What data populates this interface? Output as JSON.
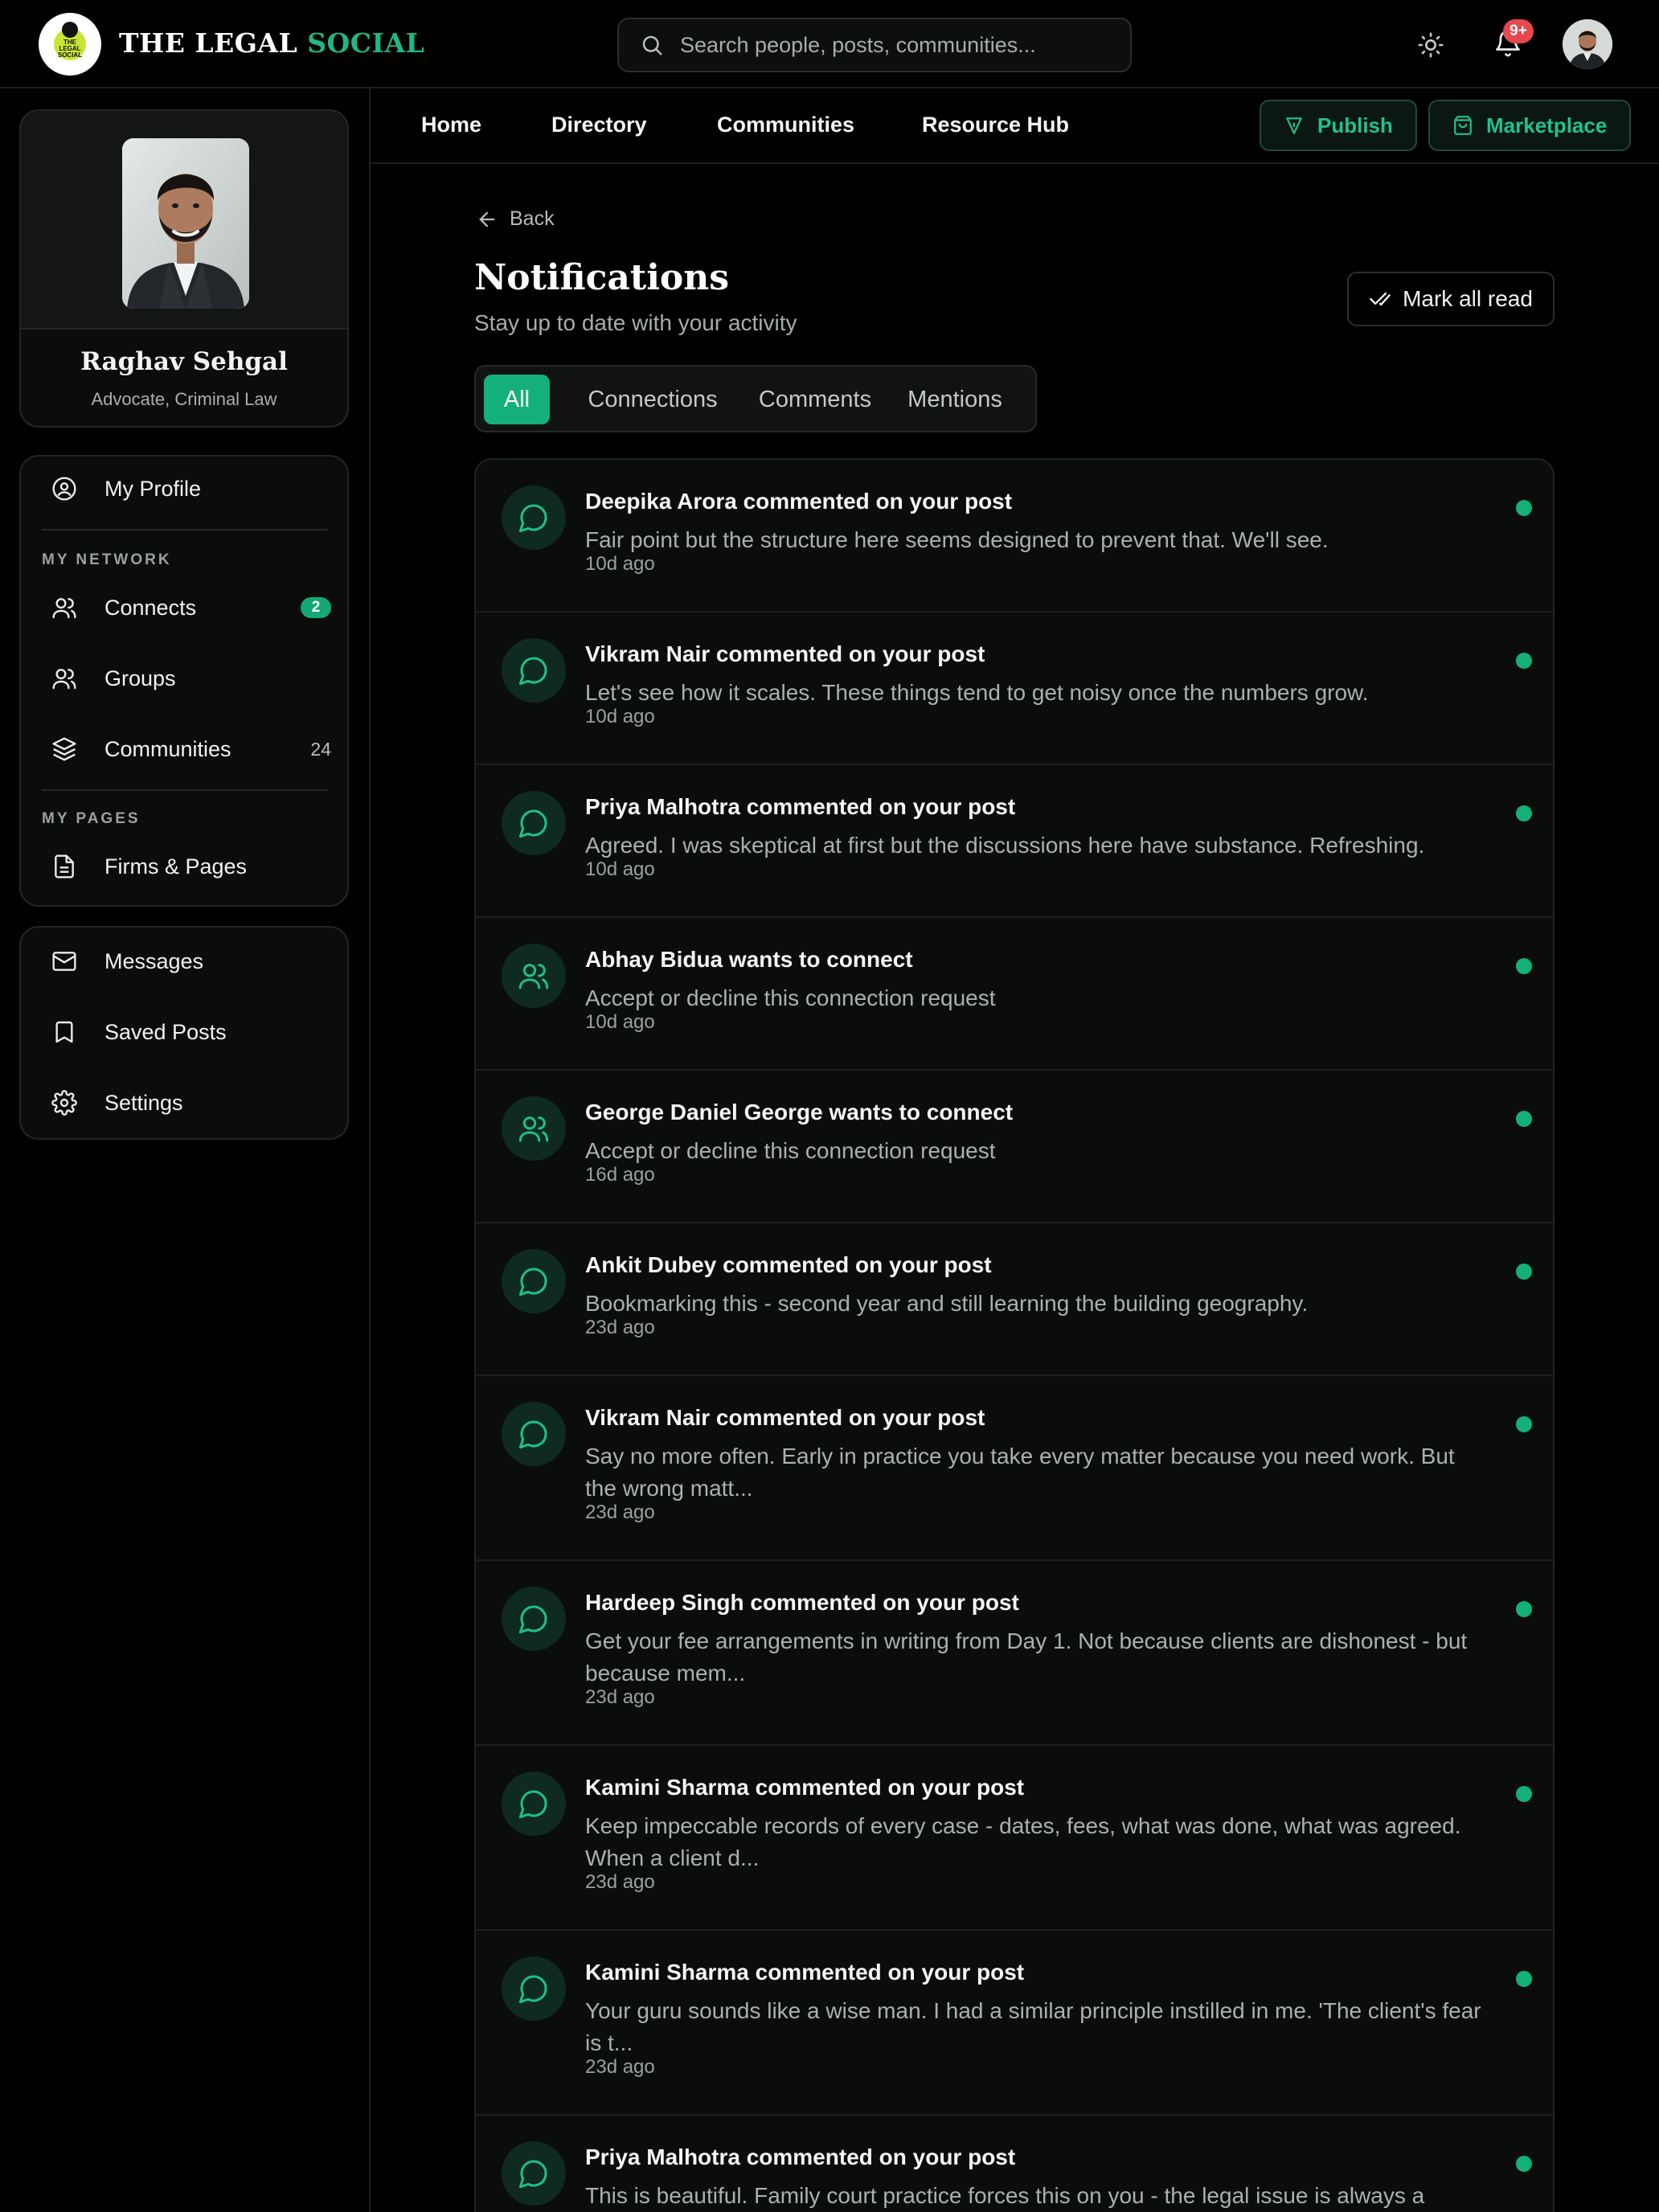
{
  "brand": {
    "name_part1": "THE LEGAL ",
    "name_part2": "SOCIAL",
    "logo_text": "THE LEGAL SOCIAL",
    "accent_color": "#20b783"
  },
  "search": {
    "placeholder": "Search people, posts, communities..."
  },
  "header": {
    "notification_badge": "9+"
  },
  "profile": {
    "name": "Raghav Sehgal",
    "role": "Advocate, Criminal Law"
  },
  "sidebar": {
    "my_profile": "My Profile",
    "network_label": "MY NETWORK",
    "connects": "Connects",
    "connects_badge": "2",
    "groups": "Groups",
    "communities": "Communities",
    "communities_count": "24",
    "pages_label": "MY PAGES",
    "firms_pages": "Firms & Pages",
    "messages": "Messages",
    "saved_posts": "Saved Posts",
    "settings": "Settings"
  },
  "topnav": {
    "home": "Home",
    "directory": "Directory",
    "communities": "Communities",
    "resource_hub": "Resource Hub",
    "publish": "Publish",
    "marketplace": "Marketplace"
  },
  "page": {
    "back": "Back",
    "title": "Notifications",
    "subtitle": "Stay up to date with your activity",
    "mark_all_read": "Mark all read"
  },
  "tabs": [
    "All",
    "Connections",
    "Comments",
    "Mentions"
  ],
  "notifications": [
    {
      "type": "comment",
      "title": "Deepika Arora commented on your post",
      "message": "Fair point but the structure here seems designed to prevent that. We'll see.",
      "time": "10d ago"
    },
    {
      "type": "comment",
      "title": "Vikram Nair commented on your post",
      "message": "Let's see how it scales. These things tend to get noisy once the numbers grow.",
      "time": "10d ago"
    },
    {
      "type": "comment",
      "title": "Priya Malhotra commented on your post",
      "message": "Agreed. I was skeptical at first but the discussions here have substance. Refreshing.",
      "time": "10d ago"
    },
    {
      "type": "connect",
      "title": "Abhay Bidua wants to connect",
      "message": "Accept or decline this connection request",
      "time": "10d ago"
    },
    {
      "type": "connect",
      "title": "George Daniel George wants to connect",
      "message": "Accept or decline this connection request",
      "time": "16d ago"
    },
    {
      "type": "comment",
      "title": "Ankit Dubey commented on your post",
      "message": "Bookmarking this - second year and still learning the building geography.",
      "time": "23d ago"
    },
    {
      "type": "comment",
      "title": "Vikram Nair commented on your post",
      "message": "Say no more often. Early in practice you take every matter because you need work. But the wrong matt...",
      "time": "23d ago"
    },
    {
      "type": "comment",
      "title": "Hardeep Singh commented on your post",
      "message": "Get your fee arrangements in writing from Day 1. Not because clients are dishonest - but because mem...",
      "time": "23d ago"
    },
    {
      "type": "comment",
      "title": "Kamini Sharma commented on your post",
      "message": "Keep impeccable records of every case - dates, fees, what was done, what was agreed. When a client d...",
      "time": "23d ago"
    },
    {
      "type": "comment",
      "title": "Kamini Sharma commented on your post",
      "message": "Your guru sounds like a wise man. I had a similar principle instilled in me. 'The client's fear is t...",
      "time": "23d ago"
    },
    {
      "type": "comment",
      "title": "Priya Malhotra commented on your post",
      "message": "This is beautiful. Family court practice forces this on you - the legal issue is always a",
      "time": ""
    }
  ]
}
